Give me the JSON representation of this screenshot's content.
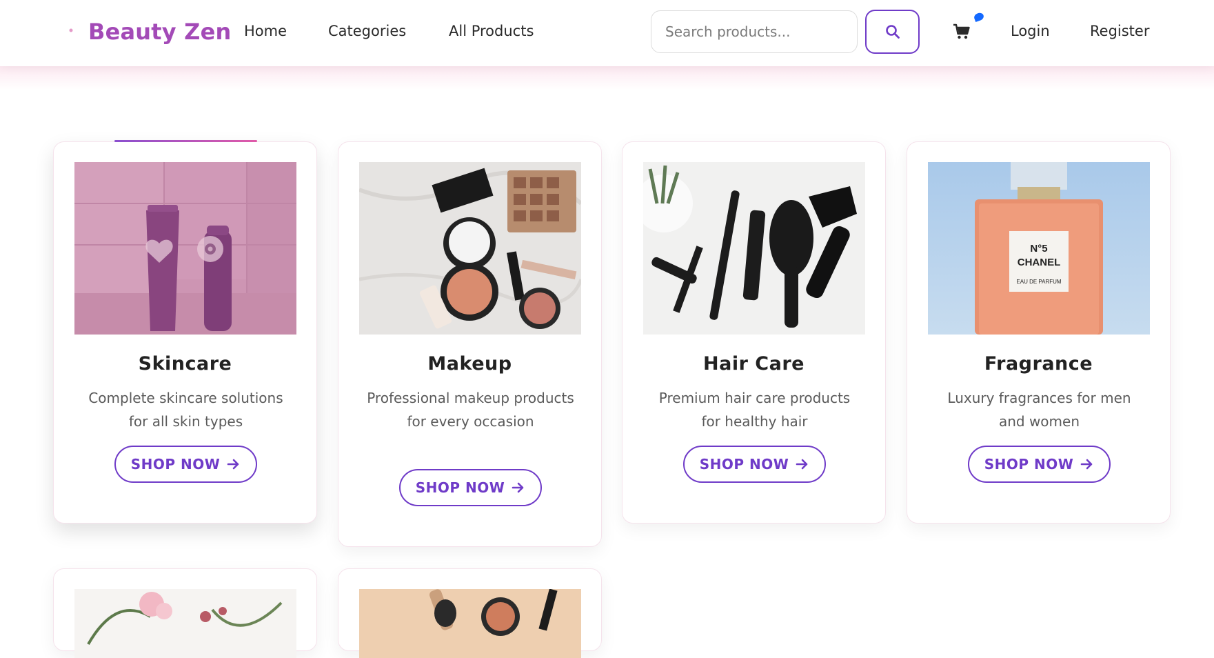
{
  "header": {
    "brand": "Beauty Zen",
    "nav": {
      "home": "Home",
      "categories": "Categories",
      "all_products": "All Products"
    },
    "search": {
      "placeholder": "Search products...",
      "icon": "search-icon"
    },
    "cart_icon": "cart-icon",
    "login": "Login",
    "register": "Register"
  },
  "colors": {
    "brand": "#a34ab7",
    "accent": "#6f3bc8",
    "badge": "#1469ff"
  },
  "categories": [
    {
      "title": "Skincare",
      "description": "Complete skincare solutions for all skin types",
      "button": "SHOP NOW",
      "icon": "arrow-right-icon",
      "overlay_icons": [
        "heart-icon",
        "eye-icon"
      ]
    },
    {
      "title": "Makeup",
      "description": "Professional makeup products for every occasion",
      "button": "SHOP NOW",
      "icon": "arrow-right-icon"
    },
    {
      "title": "Hair Care",
      "description": "Premium hair care products for healthy hair",
      "button": "SHOP NOW",
      "icon": "arrow-right-icon"
    },
    {
      "title": "Fragrance",
      "description": "Luxury fragrances for men and women",
      "button": "SHOP NOW",
      "icon": "arrow-right-icon",
      "image_text": {
        "line1": "N°5",
        "line2": "CHANEL",
        "line3": "EAU DE PARFUM"
      }
    }
  ]
}
